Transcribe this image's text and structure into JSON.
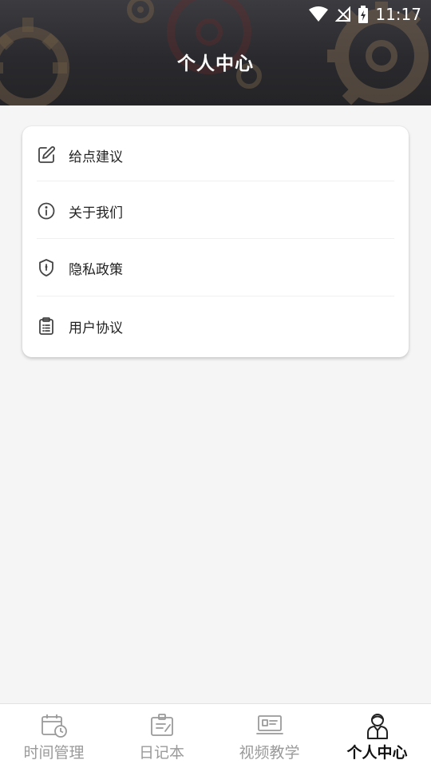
{
  "status_bar": {
    "time": "11:17"
  },
  "header": {
    "title": "个人中心"
  },
  "menu": {
    "items": [
      {
        "label": "给点建议",
        "icon": "edit-icon"
      },
      {
        "label": "关于我们",
        "icon": "info-icon"
      },
      {
        "label": "隐私政策",
        "icon": "shield-icon"
      },
      {
        "label": "用户协议",
        "icon": "clipboard-icon"
      }
    ]
  },
  "bottom_nav": {
    "items": [
      {
        "label": "时间管理",
        "icon": "calendar-clock-icon"
      },
      {
        "label": "日记本",
        "icon": "notebook-icon"
      },
      {
        "label": "视频教学",
        "icon": "monitor-icon"
      },
      {
        "label": "个人中心",
        "icon": "person-icon",
        "active": true
      }
    ]
  },
  "colors": {
    "header_bg": "#2a2a2e",
    "page_bg": "#f5f5f5",
    "active_nav": "#111111",
    "inactive_nav": "#9a9a9a"
  }
}
